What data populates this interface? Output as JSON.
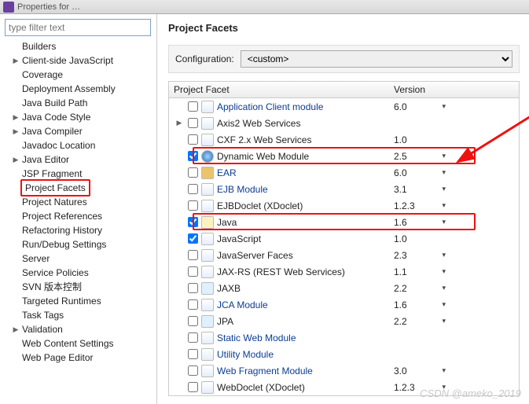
{
  "window_title": "Properties for …",
  "filter_placeholder": "type filter text",
  "sidebar_items": [
    {
      "label": "Builders",
      "exp": false
    },
    {
      "label": "Client-side JavaScript",
      "exp": true
    },
    {
      "label": "Coverage",
      "exp": false
    },
    {
      "label": "Deployment Assembly",
      "exp": false
    },
    {
      "label": "Java Build Path",
      "exp": false
    },
    {
      "label": "Java Code Style",
      "exp": true
    },
    {
      "label": "Java Compiler",
      "exp": true
    },
    {
      "label": "Javadoc Location",
      "exp": false
    },
    {
      "label": "Java Editor",
      "exp": true
    },
    {
      "label": "JSP Fragment",
      "exp": false
    },
    {
      "label": "Project Facets",
      "exp": false,
      "selected": true
    },
    {
      "label": "Project Natures",
      "exp": false
    },
    {
      "label": "Project References",
      "exp": false
    },
    {
      "label": "Refactoring History",
      "exp": false
    },
    {
      "label": "Run/Debug Settings",
      "exp": false
    },
    {
      "label": "Server",
      "exp": false
    },
    {
      "label": "Service Policies",
      "exp": false
    },
    {
      "label": "SVN 版本控制",
      "exp": false
    },
    {
      "label": "Targeted Runtimes",
      "exp": false
    },
    {
      "label": "Task Tags",
      "exp": false
    },
    {
      "label": "Validation",
      "exp": true
    },
    {
      "label": "Web Content Settings",
      "exp": false
    },
    {
      "label": "Web Page Editor",
      "exp": false
    }
  ],
  "page_heading": "Project Facets",
  "config_label": "Configuration:",
  "config_value": "<custom>",
  "col_facet": "Project Facet",
  "col_version": "Version",
  "facets": [
    {
      "name": "Application Client module",
      "checked": false,
      "version": "6.0",
      "dd": true,
      "icon": "doc",
      "blue": true,
      "tw": ""
    },
    {
      "name": "Axis2 Web Services",
      "checked": false,
      "version": "",
      "dd": false,
      "icon": "doc",
      "tw": "▶"
    },
    {
      "name": "CXF 2.x Web Services",
      "checked": false,
      "version": "1.0",
      "dd": false,
      "icon": "doc",
      "tw": ""
    },
    {
      "name": "Dynamic Web Module",
      "checked": true,
      "version": "2.5",
      "dd": true,
      "icon": "globe",
      "tw": "",
      "hl": true
    },
    {
      "name": "EAR",
      "checked": false,
      "version": "6.0",
      "dd": true,
      "icon": "ear",
      "blue": true,
      "tw": ""
    },
    {
      "name": "EJB Module",
      "checked": false,
      "version": "3.1",
      "dd": true,
      "icon": "doc",
      "blue": true,
      "tw": ""
    },
    {
      "name": "EJBDoclet (XDoclet)",
      "checked": false,
      "version": "1.2.3",
      "dd": true,
      "icon": "doc",
      "tw": ""
    },
    {
      "name": "Java",
      "checked": true,
      "version": "1.6",
      "dd": true,
      "icon": "java",
      "tw": "",
      "hl": true
    },
    {
      "name": "JavaScript",
      "checked": true,
      "version": "1.0",
      "dd": false,
      "icon": "doc",
      "tw": ""
    },
    {
      "name": "JavaServer Faces",
      "checked": false,
      "version": "2.3",
      "dd": true,
      "icon": "doc",
      "tw": ""
    },
    {
      "name": "JAX-RS (REST Web Services)",
      "checked": false,
      "version": "1.1",
      "dd": true,
      "icon": "doc",
      "tw": ""
    },
    {
      "name": "JAXB",
      "checked": false,
      "version": "2.2",
      "dd": true,
      "icon": "code",
      "tw": ""
    },
    {
      "name": "JCA Module",
      "checked": false,
      "version": "1.6",
      "dd": true,
      "icon": "doc",
      "blue": true,
      "tw": ""
    },
    {
      "name": "JPA",
      "checked": false,
      "version": "2.2",
      "dd": true,
      "icon": "code",
      "tw": ""
    },
    {
      "name": "Static Web Module",
      "checked": false,
      "version": "",
      "dd": false,
      "icon": "doc",
      "blue": true,
      "tw": ""
    },
    {
      "name": "Utility Module",
      "checked": false,
      "version": "",
      "dd": false,
      "icon": "doc",
      "blue": true,
      "tw": ""
    },
    {
      "name": "Web Fragment Module",
      "checked": false,
      "version": "3.0",
      "dd": true,
      "icon": "doc",
      "blue": true,
      "tw": ""
    },
    {
      "name": "WebDoclet (XDoclet)",
      "checked": false,
      "version": "1.2.3",
      "dd": true,
      "icon": "doc",
      "tw": ""
    }
  ],
  "watermark": "CSDN @ameko_2019"
}
